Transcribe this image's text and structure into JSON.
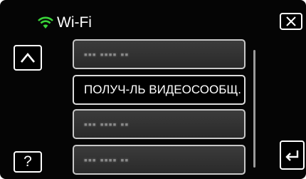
{
  "header": {
    "title": "Wi-Fi",
    "wifi_icon": "wifi-icon",
    "wifi_color": "#39d339"
  },
  "buttons": {
    "close_icon": "close-icon",
    "up_icon": "chevron-up-icon",
    "help_label": "?",
    "back_icon": "return-icon"
  },
  "list": {
    "items": [
      {
        "label": "▪▪▪ ▪▪▪▪ ▪▪",
        "placeholder": true
      },
      {
        "label": "ПОЛУЧ-ЛЬ ВИДЕОСООБЩ.",
        "placeholder": false
      },
      {
        "label": "▪▪▪ ▪▪▪▪ ▪▪",
        "placeholder": true
      },
      {
        "label": "▪▪▪ ▪▪▪▪ ▪▪",
        "placeholder": true
      }
    ]
  }
}
